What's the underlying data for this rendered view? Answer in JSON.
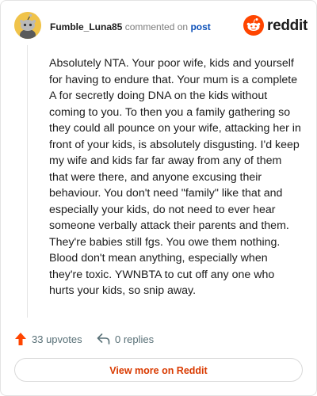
{
  "header": {
    "author": "Fumble_Luna85",
    "commented_text": "commented on",
    "post_link": "post",
    "brand": "reddit"
  },
  "comment": {
    "body": "Absolutely NTA. Your poor wife, kids and yourself for having to endure that. Your mum is a complete A for secretly doing DNA on the kids without coming to you. To then you a family gathering so they could all pounce on your wife, attacking her in front of your kids, is absolutely disgusting. I'd keep my wife and kids far far away from any of them that were there, and anyone excusing their behaviour. You don't need \"family\" like that and especially your kids, do not need to ever hear someone verbally attack their parents and them. They're babies still fgs. You owe them nothing. Blood don't mean anything, especially when they're toxic. YWNBTA to cut off any one who hurts your kids, so snip away."
  },
  "actions": {
    "upvotes": "33 upvotes",
    "replies": "0 replies"
  },
  "footer": {
    "view_more": "View more on Reddit"
  },
  "colors": {
    "upvote_arrow": "#ff4500",
    "brand_orange": "#ff4500",
    "link_blue": "#0b4fb8",
    "view_more_text": "#d93a00"
  },
  "icons": {
    "avatar": "snoo-avatar-icon",
    "brand": "reddit-snoo-icon",
    "upvote": "upvote-arrow-icon",
    "reply": "reply-arrow-icon"
  }
}
